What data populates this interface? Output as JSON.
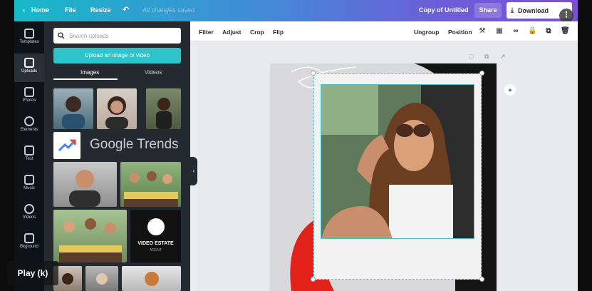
{
  "topbar": {
    "home": "Home",
    "file": "File",
    "resize": "Resize",
    "status": "All changes saved",
    "doc_title": "Copy of Untitled",
    "share": "Share",
    "download": "Download"
  },
  "rail": [
    {
      "label": "Templates",
      "icon": "templates-icon"
    },
    {
      "label": "Uploads",
      "icon": "uploads-icon"
    },
    {
      "label": "Photos",
      "icon": "photos-icon"
    },
    {
      "label": "Elements",
      "icon": "elements-icon"
    },
    {
      "label": "Text",
      "icon": "text-icon"
    },
    {
      "label": "Music",
      "icon": "music-icon"
    },
    {
      "label": "Videos",
      "icon": "videos-icon"
    },
    {
      "label": "Bkground",
      "icon": "background-icon"
    }
  ],
  "uploads": {
    "search_placeholder": "Search uploads",
    "upload_button": "Upload an image or video",
    "tab_images": "Images",
    "tab_videos": "Videos",
    "google_trends": "Google Trends",
    "video_estate_title": "VIDEO ESTATE",
    "video_estate_sub": "AGENT"
  },
  "toolbar": {
    "filter": "Filter",
    "adjust": "Adjust",
    "crop": "Crop",
    "flip": "Flip",
    "ungroup": "Ungroup",
    "position": "Position"
  },
  "player": {
    "play_label": "Play (k)"
  },
  "colors": {
    "accent_teal": "#2ec4c9",
    "panel_bg": "#252a31",
    "rail_bg": "#0e1318",
    "topbar_gradient_start": "#17b9c8",
    "topbar_gradient_end": "#7d4fd8"
  }
}
